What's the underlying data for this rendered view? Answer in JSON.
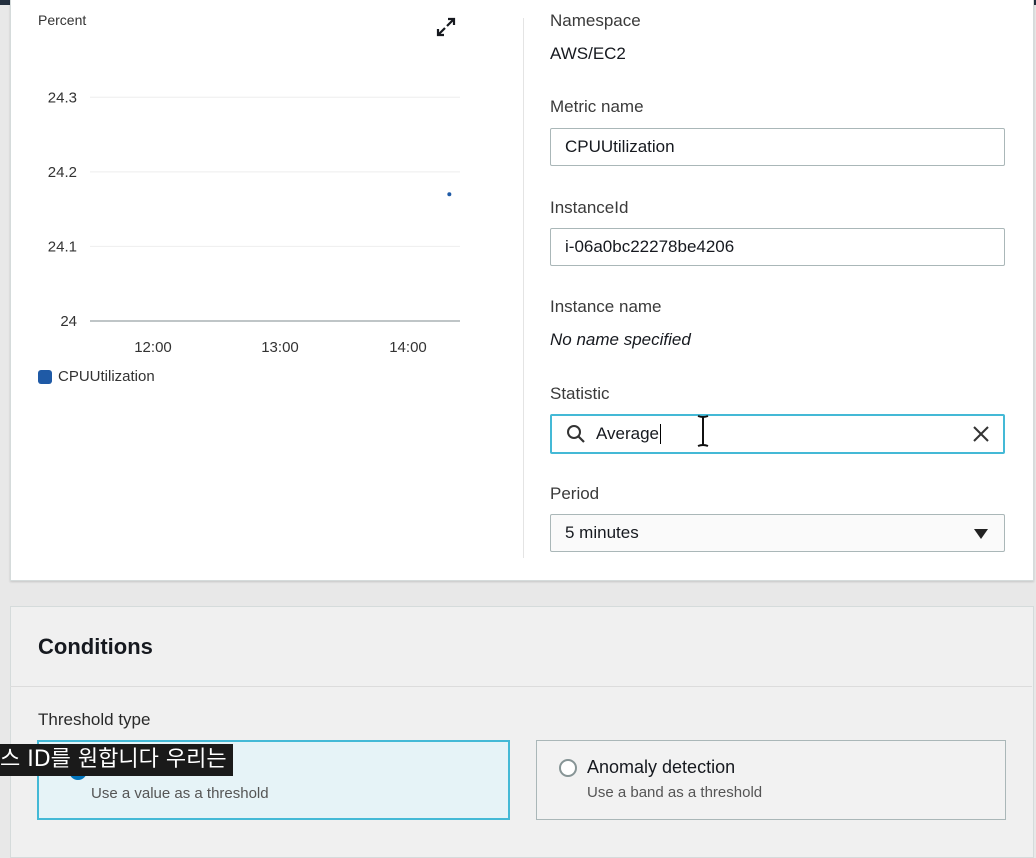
{
  "chart": {
    "ylabel": "Percent",
    "legend_label": "CPUUtilization",
    "legend_color": "#1f5aa6"
  },
  "chart_data": {
    "type": "scatter",
    "ylabel": "Percent",
    "ylim": [
      24,
      24.35
    ],
    "yticks": [
      "24.3",
      "24.2",
      "24.1",
      "24"
    ],
    "yticks_values": [
      24.3,
      24.2,
      24.1,
      24.0
    ],
    "xticks": [
      "12:00",
      "13:00",
      "14:00"
    ],
    "grid": true,
    "legend_placement": "bottom-left",
    "series": [
      {
        "name": "CPUUtilization",
        "points": [
          {
            "x": "14:20",
            "y": 24.17
          }
        ]
      }
    ]
  },
  "metric": {
    "namespace_label": "Namespace",
    "namespace_value": "AWS/EC2",
    "metric_name_label": "Metric name",
    "metric_name_value": "CPUUtilization",
    "instance_id_label": "InstanceId",
    "instance_id_value": "i-06a0bc22278be4206",
    "instance_name_label": "Instance name",
    "instance_name_value": "No name specified",
    "statistic_label": "Statistic",
    "statistic_value": "Average",
    "period_label": "Period",
    "period_value": "5 minutes"
  },
  "conditions": {
    "title": "Conditions",
    "threshold_type_label": "Threshold type",
    "static_desc": "Use a value as a threshold",
    "anomaly_title": "Anomaly detection",
    "anomaly_desc": "Use a band as a threshold"
  },
  "subtitle": "스 ID를 원합니다 우리는",
  "colors": {
    "accent": "#44b9d6",
    "radio": "#0073bb",
    "header": "#232f3e"
  },
  "icons": {
    "expand": "expand-icon",
    "search": "search-icon",
    "clear": "close-icon",
    "dropdown": "caret-down-icon",
    "cursor": "text-cursor-icon"
  }
}
